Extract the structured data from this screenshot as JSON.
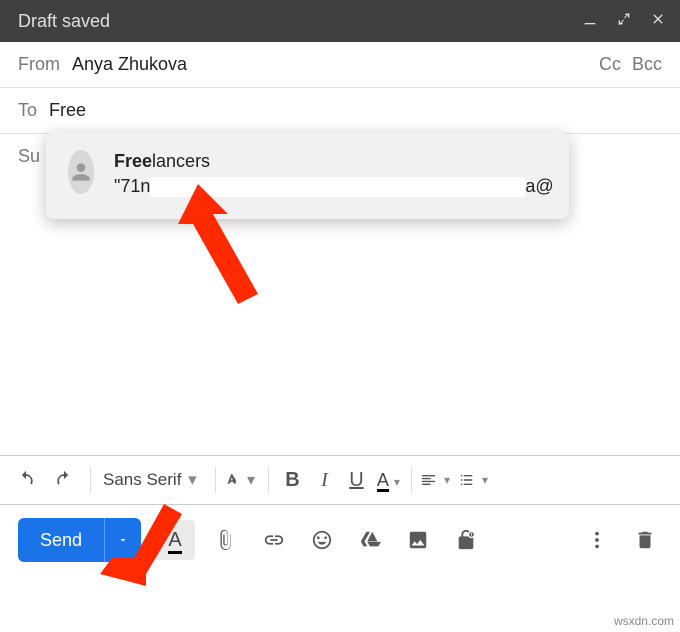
{
  "header": {
    "title": "Draft saved"
  },
  "from": {
    "label": "From",
    "value": "Anya Zhukova"
  },
  "cc": "Cc",
  "bcc": "Bcc",
  "to": {
    "label": "To",
    "value": "Free"
  },
  "subject": {
    "label": "Su"
  },
  "suggestion": {
    "bold": "Free",
    "rest": "lancers",
    "sub_prefix": "\"71n",
    "sub_suffix": "a@"
  },
  "toolbar": {
    "font": "Sans Serif",
    "b": "B",
    "i": "I",
    "u": "U",
    "a": "A",
    "a2": "A"
  },
  "send": {
    "label": "Send"
  },
  "watermark": "wsxdn.com"
}
